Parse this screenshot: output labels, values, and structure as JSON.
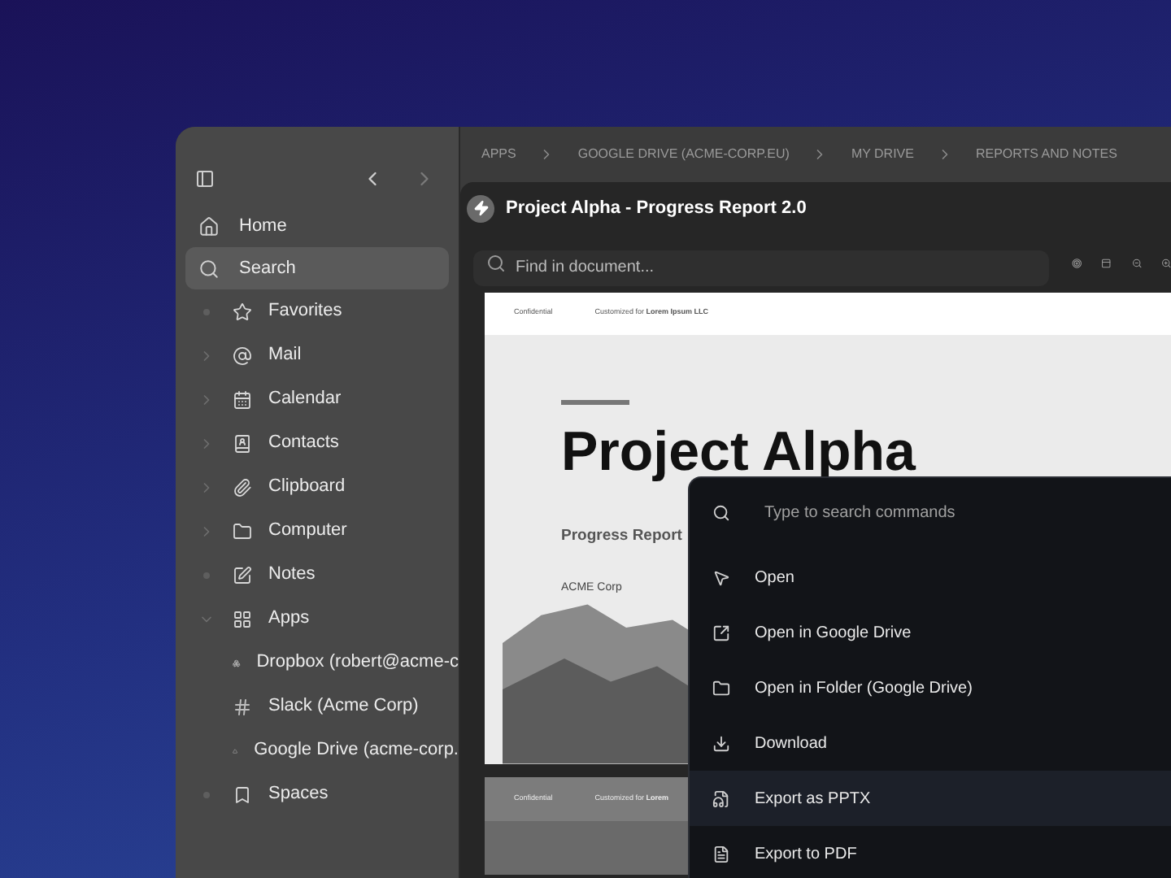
{
  "sidebar": {
    "items": [
      {
        "kind": "link",
        "label": "Home",
        "selected": false
      },
      {
        "kind": "link",
        "label": "Search",
        "selected": true
      },
      {
        "kind": "leaf",
        "label": "Favorites"
      },
      {
        "kind": "folder",
        "label": "Mail",
        "expanded": false
      },
      {
        "kind": "folder",
        "label": "Calendar",
        "expanded": false
      },
      {
        "kind": "folder",
        "label": "Contacts",
        "expanded": false
      },
      {
        "kind": "folder",
        "label": "Clipboard",
        "expanded": false
      },
      {
        "kind": "folder",
        "label": "Computer",
        "expanded": false
      },
      {
        "kind": "leaf",
        "label": "Notes"
      },
      {
        "kind": "folder",
        "label": "Apps",
        "expanded": true,
        "children": [
          {
            "label": "Dropbox (robert@acme-c"
          },
          {
            "label": "Slack (Acme Corp)"
          },
          {
            "label": "Google Drive (acme-corp."
          }
        ]
      },
      {
        "kind": "leaf",
        "label": "Spaces"
      }
    ]
  },
  "breadcrumbs": [
    "APPS",
    "GOOGLE DRIVE (ACME-CORP.EU)",
    "MY DRIVE",
    "REPORTS AND NOTES"
  ],
  "viewer": {
    "title": "Project Alpha - Progress Report 2.0",
    "search": {
      "placeholder": "Find in document..."
    }
  },
  "document": {
    "pages": [
      {
        "header_left": "Confidential",
        "header_right": "Customized for **Lorem Ipsum LLC**",
        "title": "Project Alpha",
        "subtitle": "Progress Report",
        "company": "ACME Corp"
      },
      {
        "header_left": "Confidential",
        "header_right": "Customized for **Lorem**"
      }
    ]
  },
  "command_palette": {
    "placeholder": "Type to search commands",
    "items": [
      {
        "label": "Open",
        "selected": false
      },
      {
        "label": "Open in Google Drive",
        "selected": false
      },
      {
        "label": "Open in Folder (Google Drive)",
        "selected": false
      },
      {
        "label": "Download",
        "selected": false
      },
      {
        "label": "Export as PPTX",
        "selected": true
      },
      {
        "label": "Export to PDF",
        "selected": false
      }
    ]
  }
}
